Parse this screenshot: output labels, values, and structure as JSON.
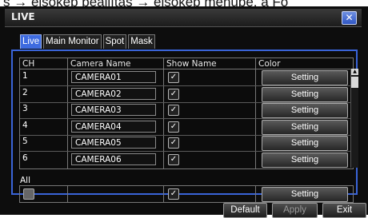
{
  "top_strip_text": "s → elsőkép beállítás → elsőkép menübe, a Fő",
  "window": {
    "title": "LIVE",
    "close_glyph": "✕"
  },
  "tabs": [
    "Live",
    "Main Monitor",
    "Spot",
    "Mask"
  ],
  "table": {
    "headers": {
      "ch": "CH",
      "camera_name": "Camera Name",
      "show_name": "Show Name",
      "color": "Color"
    },
    "rows": [
      {
        "ch": "1",
        "camera_name": "CAMERA01",
        "show_name": "✓",
        "color": "Setting"
      },
      {
        "ch": "2",
        "camera_name": "CAMERA02",
        "show_name": "✓",
        "color": "Setting"
      },
      {
        "ch": "3",
        "camera_name": "CAMERA03",
        "show_name": "✓",
        "color": "Setting"
      },
      {
        "ch": "4",
        "camera_name": "CAMERA04",
        "show_name": "✓",
        "color": "Setting"
      },
      {
        "ch": "5",
        "camera_name": "CAMERA05",
        "show_name": "✓",
        "color": "Setting"
      },
      {
        "ch": "6",
        "camera_name": "CAMERA06",
        "show_name": "✓",
        "color": "Setting"
      }
    ]
  },
  "all": {
    "label": "All",
    "show_name": "✓",
    "color": "Setting"
  },
  "footer": {
    "default": "Default",
    "apply": "Apply",
    "exit": "Exit"
  },
  "colors": {
    "accent": "#3a64d8",
    "tab_active": "#3e6be0",
    "background": "#0d0d0d"
  }
}
